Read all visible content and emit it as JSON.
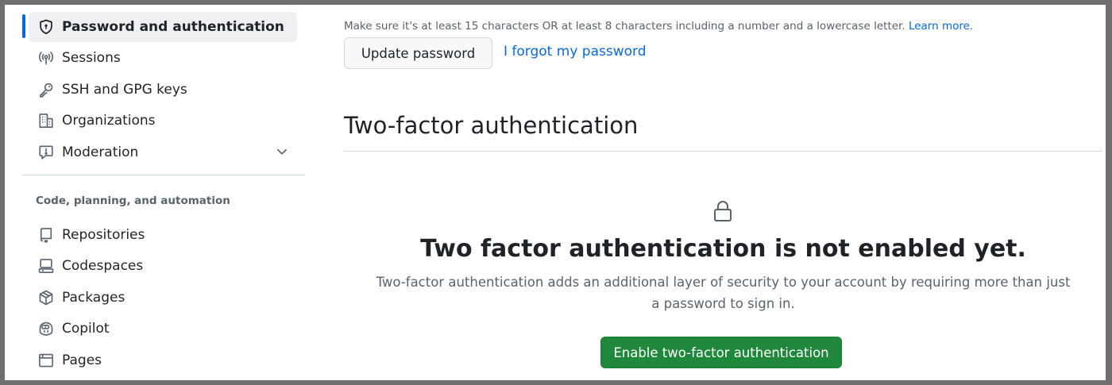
{
  "sidebar": {
    "items_top": [
      {
        "label": "Password and authentication",
        "icon": "shield-lock-icon",
        "active": true
      },
      {
        "label": "Sessions",
        "icon": "broadcast-icon"
      },
      {
        "label": "SSH and GPG keys",
        "icon": "key-icon"
      },
      {
        "label": "Organizations",
        "icon": "organization-icon"
      },
      {
        "label": "Moderation",
        "icon": "report-icon",
        "expandable": true
      }
    ],
    "section_title": "Code, planning, and automation",
    "items_bottom": [
      {
        "label": "Repositories",
        "icon": "repo-icon"
      },
      {
        "label": "Codespaces",
        "icon": "codespaces-icon"
      },
      {
        "label": "Packages",
        "icon": "package-icon"
      },
      {
        "label": "Copilot",
        "icon": "copilot-icon"
      },
      {
        "label": "Pages",
        "icon": "browser-icon"
      }
    ]
  },
  "password": {
    "hint": "Make sure it's at least 15 characters OR at least 8 characters including a number and a lowercase letter.",
    "learn_more": "Learn more.",
    "update_button": "Update password",
    "forgot_link": "I forgot my password"
  },
  "two_factor": {
    "heading": "Two-factor authentication",
    "blank_title": "Two factor authentication is not enabled yet.",
    "blank_description": "Two-factor authentication adds an additional layer of security to your account by requiring more than just a password to sign in.",
    "enable_button": "Enable two-factor authentication"
  },
  "colors": {
    "accent": "#0969da",
    "success": "#1f883d"
  }
}
